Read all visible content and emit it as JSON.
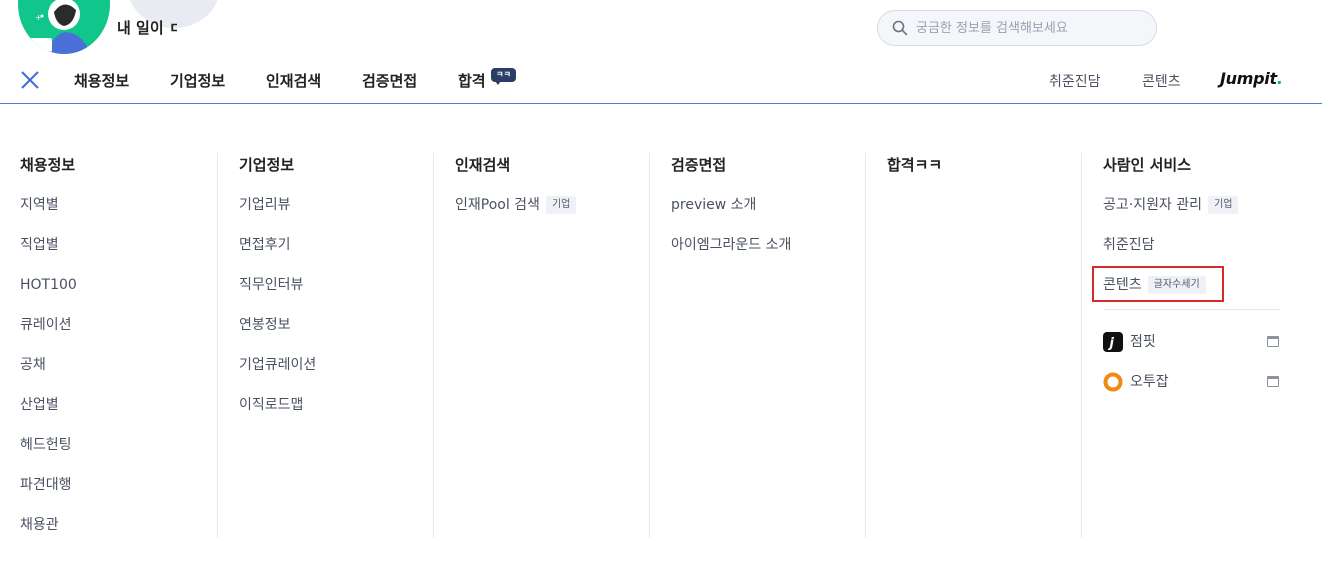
{
  "banner": {
    "text": "내 일이 ㄷ"
  },
  "search": {
    "placeholder": "궁금한 정보를 검색해보세요"
  },
  "nav": {
    "items": [
      "채용정보",
      "기업정보",
      "인재검색",
      "검증면접",
      "합격"
    ],
    "badge": "ㅋㅋ",
    "right": [
      "취준진담",
      "콘텐츠"
    ],
    "logo": {
      "text": "Jumpit",
      "dot_color": "#0bb36f"
    }
  },
  "menu": {
    "columns": [
      {
        "title": "채용정보",
        "items": [
          "지역별",
          "직업별",
          "HOT100",
          "큐레이션",
          "공채",
          "산업별",
          "헤드헌팅",
          "파견대행",
          "채용관"
        ]
      },
      {
        "title": "기업정보",
        "items": [
          "기업리뷰",
          "면접후기",
          "직무인터뷰",
          "연봉정보",
          "기업큐레이션",
          "이직로드맵"
        ]
      },
      {
        "title": "인재검색",
        "items": [
          {
            "label": "인재Pool 검색",
            "tag": "기업"
          }
        ]
      },
      {
        "title": "검증면접",
        "items": [
          "preview 소개",
          "아이엠그라운드 소개"
        ]
      },
      {
        "title": "합격ㅋㅋ",
        "items": []
      },
      {
        "title": "사람인 서비스",
        "items": [
          {
            "label": "공고·지원자 관리",
            "tag": "기업"
          },
          {
            "label": "취준진담"
          },
          {
            "label": "콘텐츠",
            "tag": "글자수세기"
          }
        ],
        "external": [
          {
            "label": "점핏",
            "icon": "jumpit-icon"
          },
          {
            "label": "오투잡",
            "icon": "otojob-icon"
          }
        ]
      }
    ]
  },
  "colors": {
    "accent": "#4d7fd9",
    "highlight": "#d72b2b",
    "banner_green": "#10c68b"
  }
}
